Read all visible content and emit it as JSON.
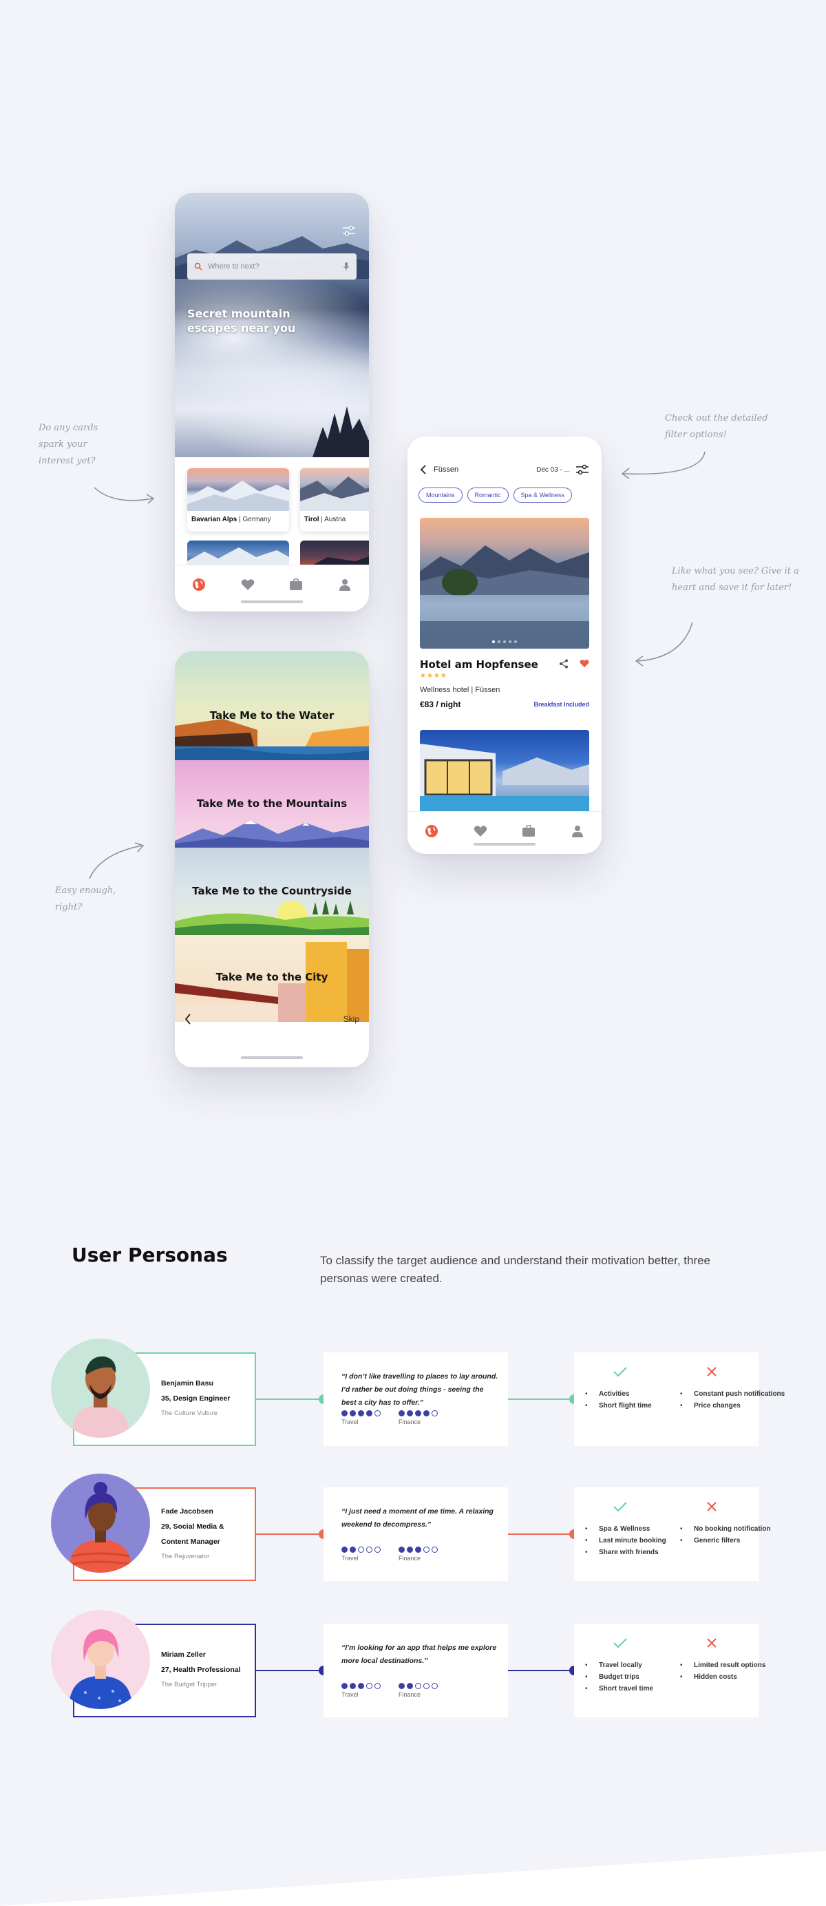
{
  "phone1": {
    "search_placeholder": "Where to next?",
    "hero_title": "Secret mountain escapes near you",
    "cards": [
      {
        "name": "Bavarian Alps",
        "country": "Germany"
      },
      {
        "name": "Tirol",
        "country": "Austria"
      }
    ],
    "tabs": [
      "globe-icon",
      "heart-icon",
      "suitcase-icon",
      "profile-icon"
    ]
  },
  "phone2": {
    "location": "Füssen",
    "date": "Dec 03 - ...",
    "chips": [
      "Mountains",
      "Romantic",
      "Spa & Wellness"
    ],
    "hotel": {
      "name": "Hotel am Hopfensee",
      "stars": 4,
      "type": "Wellness hotel | Füssen",
      "price": "€83 / night",
      "badge": "Breakfast Included"
    },
    "carousel": {
      "count": 5,
      "active": 1
    }
  },
  "phone3": {
    "categories": [
      "Take Me to the Water",
      "Take Me to the Mountains",
      "Take Me to the Countryside",
      "Take Me to the City"
    ],
    "skip_label": "Skip"
  },
  "annotations": {
    "cards": "Do any cards spark your interest yet?",
    "filters": "Check out the detailed filter options!",
    "like": "Like what you see? Give it a heart and save it for later!",
    "easy": "Easy enough, right?"
  },
  "personas_section": {
    "title": "User Personas",
    "description": "To classify the target audience and understand their motivation better, three personas were created."
  },
  "personas": [
    {
      "name": "Benjamin Basu",
      "role": "35, Design Engineer",
      "tag": "The Culture Vulture",
      "quote": "“I don’t like travelling to places to lay around. I’d rather be out doing things - seeing the best a city has to offer.”",
      "travel": 4,
      "finance": 4,
      "travel_label": "Travel",
      "finance_label": "Finance",
      "pros": [
        "Activities",
        "Short flight time"
      ],
      "cons": [
        "Constant push notifications",
        "Price changes"
      ],
      "color": "#6bd3a8"
    },
    {
      "name": "Fade Jacobsen",
      "role": "29, Social Media & Content Manager",
      "tag": "The Rejuvenator",
      "quote": "“I just need a moment of me time. A relaxing weekend to decompress.”",
      "travel": 2,
      "finance": 3,
      "travel_label": "Travel",
      "finance_label": "Finance",
      "pros": [
        "Spa & Wellness",
        "Last minute booking",
        "Share with friends"
      ],
      "cons": [
        "No booking notification",
        "Generic filters"
      ],
      "color": "#ef6a52"
    },
    {
      "name": "Miriam Zeller",
      "role": "27, Health Professional",
      "tag": "The Budget Tripper",
      "quote": "“I’m looking for an app that helps me explore more local destinations.”",
      "travel": 3,
      "finance": 2,
      "travel_label": "Travel",
      "finance_label": "Finance",
      "pros": [
        "Travel locally",
        "Budget trips",
        "Short travel time"
      ],
      "cons": [
        "Limited result options",
        "Hidden costs"
      ],
      "color": "#2e2f9a"
    }
  ],
  "colors": {
    "accent": "#3d45b8",
    "heart": "#ef5a45",
    "check": "#5fd3a0",
    "cross": "#ef5a45",
    "background": "#f3f4f9"
  }
}
